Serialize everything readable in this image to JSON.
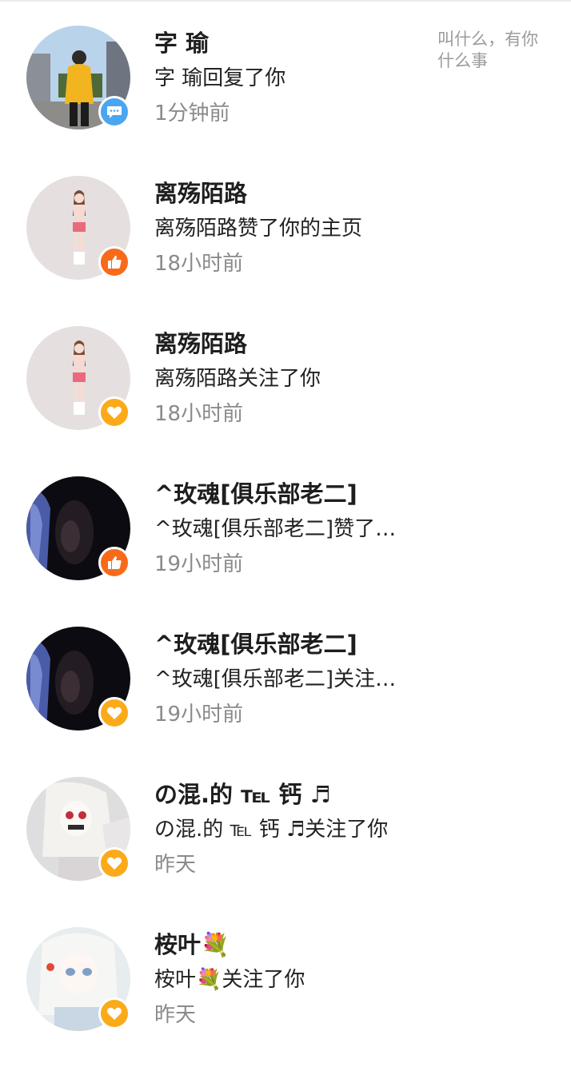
{
  "notifications": [
    {
      "name": "字  瑜",
      "action": "字  瑜回复了你",
      "time": "1分钟前",
      "type": "comment",
      "quote": "叫什么，有你什么事"
    },
    {
      "name": "离殇陌路",
      "action": "离殇陌路赞了你的主页",
      "time": "18小时前",
      "type": "like"
    },
    {
      "name": "离殇陌路",
      "action": "离殇陌路关注了你",
      "time": "18小时前",
      "type": "follow"
    },
    {
      "name": "^玫魂[俱乐部老二]",
      "action": "^玫魂[俱乐部老二]赞了…",
      "time": "19小时前",
      "type": "like"
    },
    {
      "name": "^玫魂[俱乐部老二]",
      "action": "^玫魂[俱乐部老二]关注…",
      "time": "19小时前",
      "type": "follow"
    },
    {
      "name": "の混.的 ℡ 钙 ♬",
      "action": "の混.的 ℡ 钙 ♬关注了你",
      "time": "昨天",
      "type": "follow"
    },
    {
      "name": "桉叶💐",
      "action": "桉叶💐关注了你",
      "time": "昨天",
      "type": "follow"
    }
  ],
  "badge_icons": {
    "comment": "chat-bubble-icon",
    "like": "thumbs-up-icon",
    "follow": "heart-icon"
  },
  "colors": {
    "comment_badge": "#4aa6f0",
    "like_badge": "#f86a1a",
    "follow_badge": "#fbaa1a",
    "time_text": "#8a8a8a"
  }
}
